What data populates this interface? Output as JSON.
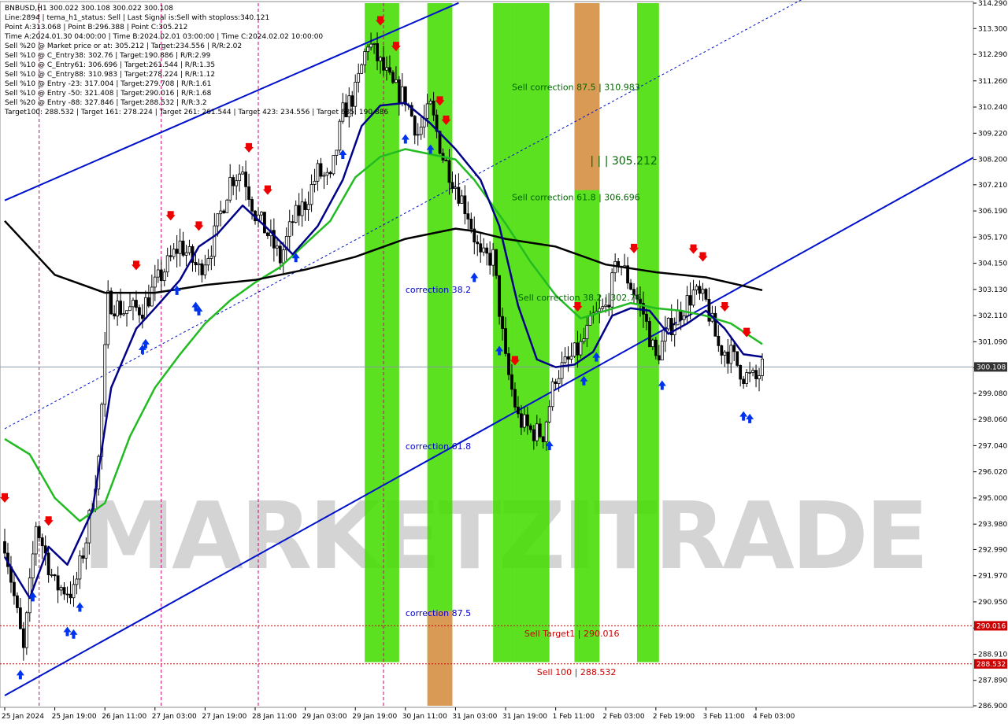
{
  "info": {
    "lines": [
      "BNBUSD,H1  300.022 300.108 300.022 300.108",
      "Line:2894 | tema_h1_status: Sell | Last Signal is:Sell with stoploss:340.121",
      "Point A:313.068 | Point B:296.388 | Point C:305.212",
      "Time A:2024.01.30 04:00:00 | Time B:2024.02.01 03:00:00 | Time C:2024.02.02 10:00:00",
      "Sell %20 @ Market price or at: 305.212 | Target:234.556 | R/R:2.02",
      "Sell %10 @ C_Entry38: 302.76 | Target:190.886 | R/R:2.99",
      "Sell %10 @ C_Entry61: 306.696 | Target:261.544 | R/R:1.35",
      "Sell %10 @ C_Entry88: 310.983 | Target:278.224 | R/R:1.12",
      "Sell %10 @ Entry -23: 317.004 | Target:279.708 | R/R:1.61",
      "Sell %10 @ Entry -50: 321.408 | Target:290.016 | R/R:1.68",
      "Sell %20 @ Entry -88: 327.846 | Target:288.532 | R/R:3.2",
      "Target100: 288.532 | Target 161: 278.224 | Target 261: 261.544 | Target 423: 234.556 | Target 685: 190.886"
    ]
  },
  "watermark": "MARKETZITRADE",
  "colors": {
    "bull": "#000000",
    "bear": "#000000",
    "green_band": "#44dd00",
    "orange_band": "#d99a55",
    "channel": "#0011cc",
    "tema_dark": "#000088",
    "ma_green": "#22bb22",
    "ma_black": "#000000",
    "sell_arrow": "#ee0000",
    "buy_arrow": "#0033ee",
    "target_line": "#cc0000",
    "price_line": "#8899aa"
  },
  "chart_data": {
    "type": "candlestick",
    "symbol": "BNBUSD",
    "timeframe": "H1",
    "ylim": [
      286.9,
      314.29
    ],
    "y_ticks": [
      "314.290",
      "313.300",
      "312.290",
      "311.260",
      "310.240",
      "309.220",
      "308.200",
      "307.210",
      "306.190",
      "305.170",
      "304.150",
      "303.130",
      "302.110",
      "301.090",
      "300.080",
      "299.080",
      "298.060",
      "297.040",
      "296.020",
      "295.000",
      "293.980",
      "292.990",
      "291.970",
      "290.950",
      "289.930",
      "288.910",
      "287.890",
      "286.900"
    ],
    "x_labels": [
      "25 Jan 2024",
      "25 Jan 19:00",
      "26 Jan 11:00",
      "27 Jan 03:00",
      "27 Jan 19:00",
      "28 Jan 11:00",
      "29 Jan 03:00",
      "29 Jan 19:00",
      "30 Jan 11:00",
      "31 Jan 03:00",
      "31 Jan 19:00",
      "1 Feb 11:00",
      "2 Feb 03:00",
      "2 Feb 19:00",
      "3 Feb 11:00",
      "4 Feb 03:00"
    ],
    "x_label_index": [
      0,
      16,
      32,
      48,
      64,
      80,
      96,
      112,
      128,
      144,
      160,
      176,
      192,
      208,
      224,
      240
    ],
    "current_price": "300.108",
    "close_path": [
      [
        0,
        293.3
      ],
      [
        6,
        289.0
      ],
      [
        10,
        294.0
      ],
      [
        16,
        291.6
      ],
      [
        22,
        291.3
      ],
      [
        26,
        293.4
      ],
      [
        30,
        296.5
      ],
      [
        33,
        302.7
      ],
      [
        38,
        302.3
      ],
      [
        44,
        302.4
      ],
      [
        50,
        303.7
      ],
      [
        56,
        304.9
      ],
      [
        62,
        303.9
      ],
      [
        66,
        304.8
      ],
      [
        72,
        307.4
      ],
      [
        76,
        307.8
      ],
      [
        80,
        306.1
      ],
      [
        84,
        305.3
      ],
      [
        88,
        304.3
      ],
      [
        92,
        305.8
      ],
      [
        96,
        306.5
      ],
      [
        100,
        307.7
      ],
      [
        104,
        307.3
      ],
      [
        108,
        310.0
      ],
      [
        112,
        310.8
      ],
      [
        116,
        312.8
      ],
      [
        120,
        311.9
      ],
      [
        124,
        311.0
      ],
      [
        128,
        310.6
      ],
      [
        132,
        309.2
      ],
      [
        136,
        310.2
      ],
      [
        140,
        308.3
      ],
      [
        144,
        307.2
      ],
      [
        148,
        306.1
      ],
      [
        152,
        304.3
      ],
      [
        156,
        304.4
      ],
      [
        160,
        300.3
      ],
      [
        164,
        298.1
      ],
      [
        168,
        297.6
      ],
      [
        172,
        297.5
      ],
      [
        176,
        299.8
      ],
      [
        180,
        300.3
      ],
      [
        184,
        300.9
      ],
      [
        188,
        302.0
      ],
      [
        192,
        302.4
      ],
      [
        196,
        304.3
      ],
      [
        200,
        303.3
      ],
      [
        204,
        302.2
      ],
      [
        208,
        300.4
      ],
      [
        212,
        301.6
      ],
      [
        216,
        302.3
      ],
      [
        220,
        303.0
      ],
      [
        224,
        302.6
      ],
      [
        228,
        300.9
      ],
      [
        232,
        300.6
      ],
      [
        236,
        299.8
      ],
      [
        240,
        299.6
      ],
      [
        242,
        300.1
      ]
    ],
    "ma_black": [
      [
        0,
        305.8
      ],
      [
        16,
        303.7
      ],
      [
        32,
        303.0
      ],
      [
        48,
        303.0
      ],
      [
        64,
        303.3
      ],
      [
        80,
        303.5
      ],
      [
        96,
        303.9
      ],
      [
        112,
        304.4
      ],
      [
        128,
        305.1
      ],
      [
        144,
        305.5
      ],
      [
        150,
        305.4
      ],
      [
        160,
        305.1
      ],
      [
        176,
        304.8
      ],
      [
        192,
        304.1
      ],
      [
        208,
        303.8
      ],
      [
        224,
        303.6
      ],
      [
        242,
        303.1
      ]
    ],
    "ma_green": [
      [
        0,
        297.3
      ],
      [
        8,
        296.7
      ],
      [
        16,
        295.0
      ],
      [
        24,
        294.1
      ],
      [
        32,
        294.8
      ],
      [
        40,
        297.4
      ],
      [
        48,
        299.3
      ],
      [
        56,
        300.6
      ],
      [
        64,
        301.8
      ],
      [
        72,
        302.7
      ],
      [
        80,
        303.4
      ],
      [
        88,
        304.0
      ],
      [
        96,
        304.9
      ],
      [
        104,
        305.8
      ],
      [
        112,
        307.5
      ],
      [
        120,
        308.3
      ],
      [
        128,
        308.6
      ],
      [
        136,
        308.4
      ],
      [
        144,
        308.2
      ],
      [
        150,
        307.4
      ],
      [
        160,
        305.7
      ],
      [
        168,
        304.2
      ],
      [
        176,
        302.9
      ],
      [
        184,
        302.0
      ],
      [
        192,
        302.3
      ],
      [
        200,
        302.6
      ],
      [
        208,
        302.4
      ],
      [
        216,
        302.3
      ],
      [
        224,
        302.1
      ],
      [
        232,
        301.8
      ],
      [
        242,
        301.0
      ]
    ],
    "tema": [
      [
        0,
        292.7
      ],
      [
        8,
        291.1
      ],
      [
        14,
        293.1
      ],
      [
        20,
        292.4
      ],
      [
        28,
        294.5
      ],
      [
        34,
        299.3
      ],
      [
        42,
        301.6
      ],
      [
        48,
        302.4
      ],
      [
        56,
        303.5
      ],
      [
        62,
        304.8
      ],
      [
        68,
        305.3
      ],
      [
        76,
        306.4
      ],
      [
        84,
        305.5
      ],
      [
        92,
        304.5
      ],
      [
        100,
        305.6
      ],
      [
        108,
        307.4
      ],
      [
        114,
        309.5
      ],
      [
        120,
        310.3
      ],
      [
        128,
        310.4
      ],
      [
        136,
        309.6
      ],
      [
        144,
        308.6
      ],
      [
        152,
        307.4
      ],
      [
        158,
        305.6
      ],
      [
        164,
        302.5
      ],
      [
        170,
        300.4
      ],
      [
        176,
        300.1
      ],
      [
        182,
        300.2
      ],
      [
        188,
        300.7
      ],
      [
        194,
        302.1
      ],
      [
        200,
        302.4
      ],
      [
        206,
        302.3
      ],
      [
        212,
        301.4
      ],
      [
        218,
        301.8
      ],
      [
        224,
        302.3
      ],
      [
        230,
        301.6
      ],
      [
        236,
        300.6
      ],
      [
        242,
        300.5
      ]
    ],
    "green_bands": [
      [
        115,
        126
      ],
      [
        135,
        143
      ],
      [
        156,
        163
      ],
      [
        163,
        174
      ],
      [
        182,
        190
      ],
      [
        202,
        209
      ]
    ],
    "orange_bands": [
      [
        135,
        143
      ],
      [
        182,
        190
      ]
    ],
    "orange_band_spans": [
      [
        135,
        143,
        "bottom"
      ],
      [
        182,
        190,
        "top"
      ]
    ],
    "channel_lines": {
      "upper": [
        [
          0,
          306.6
        ],
        [
          145,
          314.3
        ]
      ],
      "lower": [
        [
          0,
          287.3
        ],
        [
          242,
          303.7
        ]
      ],
      "middle_dashed": [
        [
          0,
          297.7
        ],
        [
          242,
          313.6
        ]
      ]
    },
    "vertical_dashed_idx": [
      11,
      50,
      81,
      121
    ],
    "sell_arrows_idx": [
      0,
      14,
      42,
      53,
      62,
      78,
      84,
      120,
      125,
      139,
      141,
      163,
      183,
      201,
      220,
      223,
      230,
      237
    ],
    "buy_arrows_idx": [
      5,
      9,
      20,
      22,
      24,
      44,
      45,
      55,
      61,
      62,
      93,
      108,
      128,
      136,
      150,
      158,
      174,
      185,
      189,
      210,
      236,
      238
    ],
    "annotations": [
      {
        "text": "Sell correction 87.5 | 310.983",
        "color": "#006600",
        "x_idx": 162,
        "y": 310.9
      },
      {
        "text": "Sell correction 61.8 | 306.696",
        "color": "#006600",
        "x_idx": 162,
        "y": 306.6
      },
      {
        "text": "Sell correction 38.2 | 302.76",
        "color": "#006600",
        "x_idx": 164,
        "y": 302.7
      },
      {
        "text": "| | | 305.212",
        "color": "#006600",
        "x_idx": 187,
        "y": 308.0,
        "size": 14
      },
      {
        "text": "correction 38.2",
        "color": "#0000cc",
        "x_idx": 128,
        "y": 303.0
      },
      {
        "text": "correction 61.8",
        "color": "#0000cc",
        "x_idx": 128,
        "y": 296.9
      },
      {
        "text": "correction 87.5",
        "color": "#0000cc",
        "x_idx": 128,
        "y": 290.4
      },
      {
        "text": "Sell Target1 | 290.016",
        "color": "#cc0000",
        "x_idx": 166,
        "y": 289.6
      },
      {
        "text": "Sell 100 | 288.532",
        "color": "#cc0000",
        "x_idx": 170,
        "y": 288.1
      }
    ],
    "target_lines": [
      {
        "value": 290.016,
        "label": "290.016",
        "color": "#cc0000"
      },
      {
        "value": 288.532,
        "label": "288.532",
        "color": "#cc0000"
      }
    ],
    "title": "",
    "xlabel": "",
    "ylabel": ""
  }
}
